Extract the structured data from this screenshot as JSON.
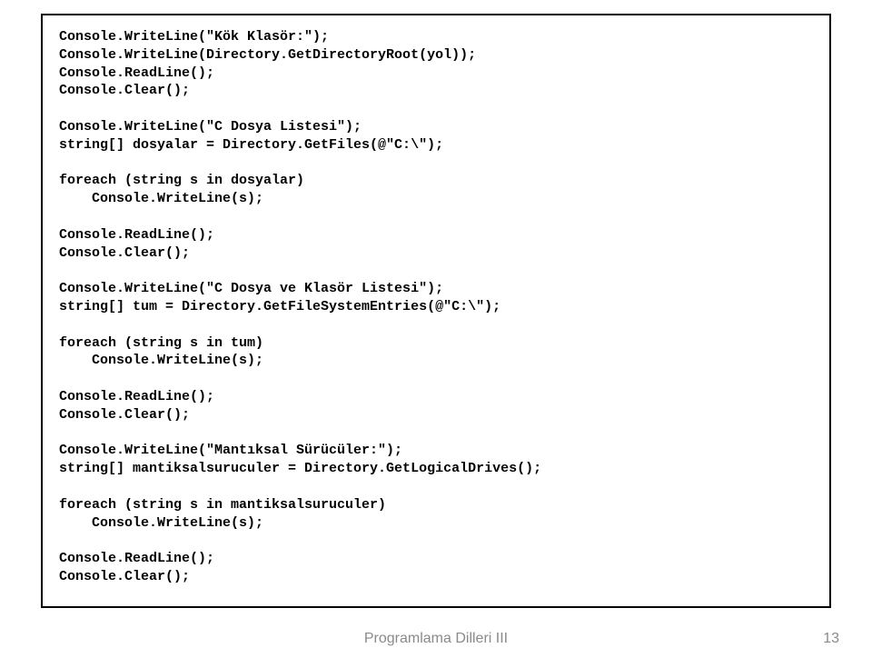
{
  "code": {
    "l01": "Console.WriteLine(\"Kök Klasör:\");",
    "l02": "Console.WriteLine(Directory.GetDirectoryRoot(yol));",
    "l03": "Console.ReadLine();",
    "l04": "Console.Clear();",
    "l05": "Console.WriteLine(\"C Dosya Listesi\");",
    "l06": "string[] dosyalar = Directory.GetFiles(@\"C:\\\");",
    "l07": "foreach (string s in dosyalar)",
    "l08": "    Console.WriteLine(s);",
    "l09": "Console.ReadLine();",
    "l10": "Console.Clear();",
    "l11": "Console.WriteLine(\"C Dosya ve Klasör Listesi\");",
    "l12": "string[] tum = Directory.GetFileSystemEntries(@\"C:\\\");",
    "l13": "foreach (string s in tum)",
    "l14": "    Console.WriteLine(s);",
    "l15": "Console.ReadLine();",
    "l16": "Console.Clear();",
    "l17": "Console.WriteLine(\"Mantıksal Sürücüler:\");",
    "l18": "string[] mantiksalsuruculer = Directory.GetLogicalDrives();",
    "l19": "foreach (string s in mantiksalsuruculer)",
    "l20": "    Console.WriteLine(s);",
    "l21": "Console.ReadLine();",
    "l22": "Console.Clear();"
  },
  "footer": {
    "title": "Programlama Dilleri III",
    "page": "13"
  }
}
